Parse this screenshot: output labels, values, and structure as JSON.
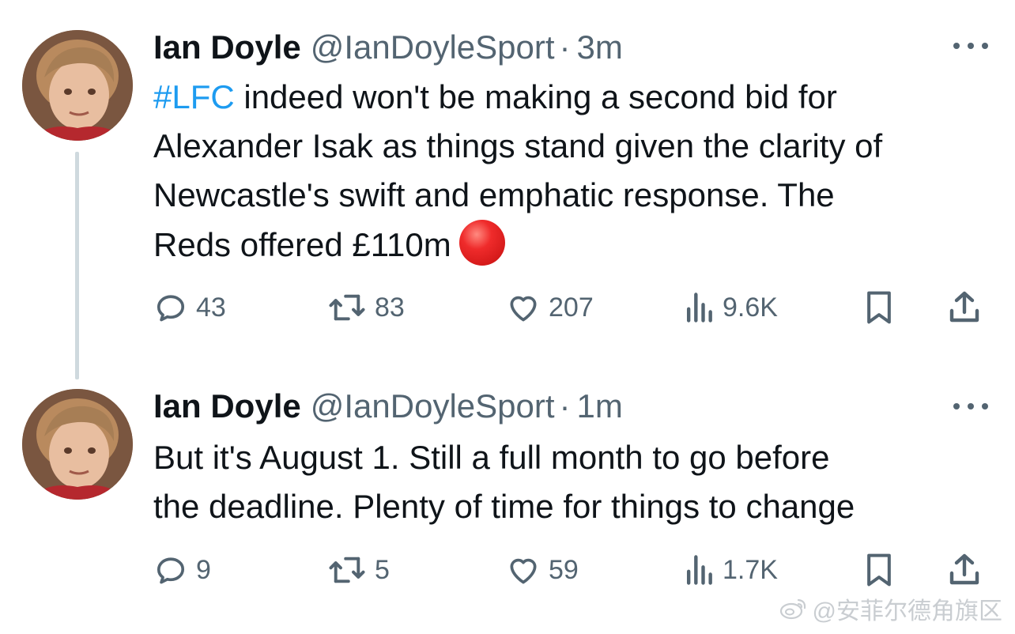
{
  "tweets": [
    {
      "name": "Ian Doyle",
      "handle": "@IanDoyleSport",
      "separator": "·",
      "time": "3m",
      "hashtag": "#LFC",
      "text_lines": [
        " indeed won't be making a second bid for",
        "Alexander Isak as things stand given the clarity of",
        "Newcastle's swift and emphatic response. The",
        "Reds offered £110m"
      ],
      "emoji": "red-circle",
      "stats": {
        "replies": "43",
        "retweets": "83",
        "likes": "207",
        "views": "9.6K"
      }
    },
    {
      "name": "Ian Doyle",
      "handle": "@IanDoyleSport",
      "separator": "·",
      "time": "1m",
      "text_lines": [
        "But it's August 1. Still a full month to go before",
        "the deadline. Plenty of time for things to change"
      ],
      "stats": {
        "replies": "9",
        "retweets": "5",
        "likes": "59",
        "views": "1.7K"
      }
    }
  ],
  "icons": {
    "reply": "reply-icon",
    "retweet": "retweet-icon",
    "like": "heart-icon",
    "views": "views-chart-icon",
    "bookmark": "bookmark-icon",
    "share": "share-icon",
    "more": "more-dots-icon"
  },
  "colors": {
    "text": "#0f1419",
    "secondary": "#536471",
    "link": "#1d9bf0",
    "thread_line": "#cfd9de"
  },
  "watermark": {
    "text": "@安菲尔德角旗区"
  }
}
